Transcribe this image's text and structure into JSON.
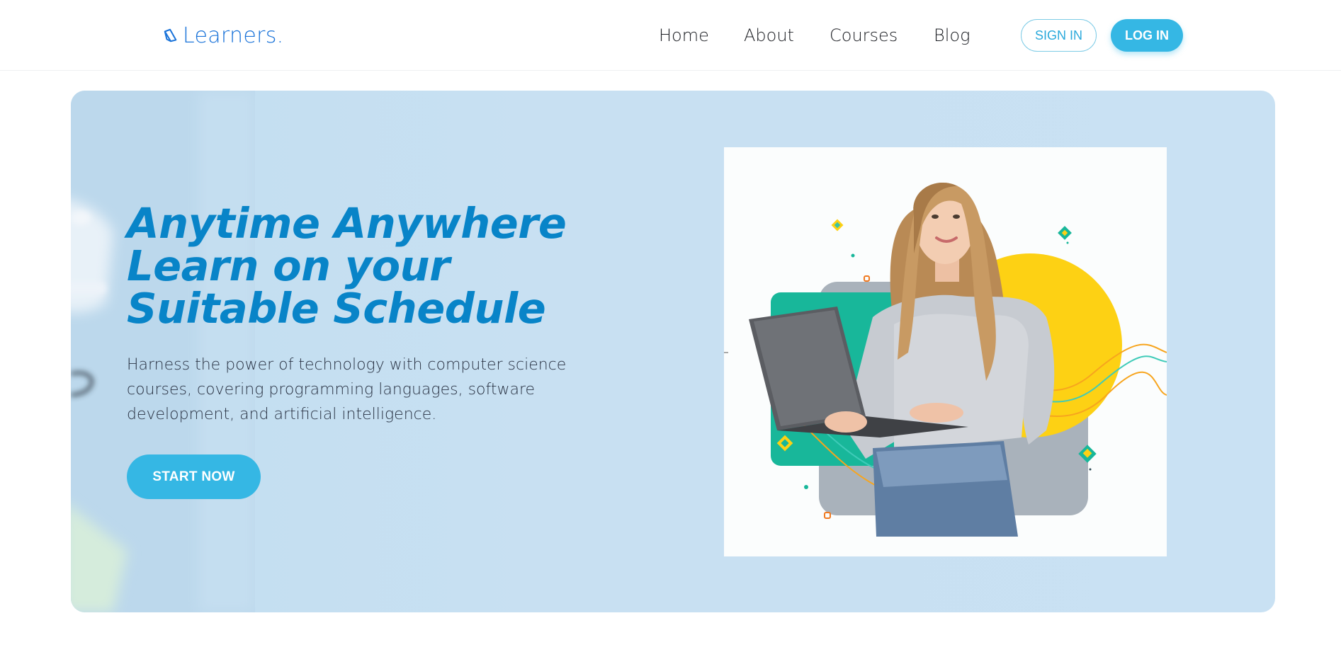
{
  "header": {
    "logo_text": "Learners.",
    "logo_icon": "book-icon",
    "nav": [
      {
        "label": "Home"
      },
      {
        "label": "About"
      },
      {
        "label": "Courses"
      },
      {
        "label": "Blog"
      }
    ],
    "sign_in_label": "SIGN IN",
    "log_in_label": "LOG IN"
  },
  "hero": {
    "title_lines": [
      "Anytime Anywhere",
      "Learn on your",
      "Suitable Schedule"
    ],
    "description_lines": [
      "Harness the power of technology with computer science",
      "courses, covering programming languages, software",
      "development, and artificial intelligence."
    ],
    "cta_label": "START NOW",
    "image": "woman-with-laptop-illustration"
  },
  "colors": {
    "brand": "#1a73d9",
    "accent": "#35b7e4",
    "title": "#0884c8",
    "hero_bg": "#c9e1f3",
    "teal": "#18b79a",
    "yellow": "#fdd114"
  }
}
